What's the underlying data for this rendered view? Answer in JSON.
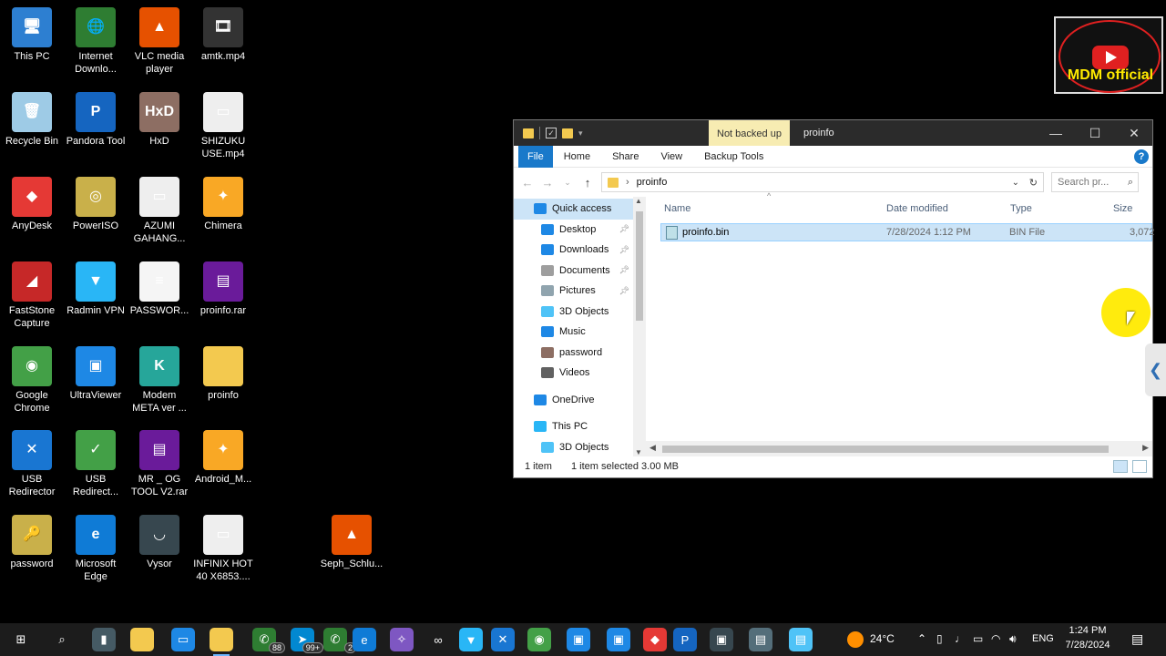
{
  "desktop": {
    "icons": [
      {
        "label": "This PC",
        "icon": "this-pc-icon",
        "color": "#2d7fd1",
        "glyph": "🖥",
        "shortcut": false
      },
      {
        "label": "Internet\nDownlo...",
        "icon": "idm-icon",
        "color": "#2e7d32",
        "glyph": "🌐",
        "shortcut": true
      },
      {
        "label": "VLC media\nplayer",
        "icon": "vlc-icon",
        "color": "#e65100",
        "glyph": "▲",
        "shortcut": true
      },
      {
        "label": "amtk.mp4",
        "icon": "video-file-icon",
        "color": "#333333",
        "glyph": "🎞",
        "shortcut": false
      },
      {
        "label": "Recycle Bin",
        "icon": "recycle-bin-icon",
        "color": "#9ecbe6",
        "glyph": "🗑",
        "shortcut": false
      },
      {
        "label": "Pandora Tool",
        "icon": "pandora-icon",
        "color": "#1565c0",
        "glyph": "P",
        "shortcut": true
      },
      {
        "label": "HxD",
        "icon": "hxd-icon",
        "color": "#8d6e63",
        "glyph": "HxD",
        "shortcut": true
      },
      {
        "label": "SHIZUKU\nUSE.mp4",
        "icon": "video-file-icon",
        "color": "#eeeeee",
        "glyph": "▭",
        "shortcut": false
      },
      {
        "label": "AnyDesk",
        "icon": "anydesk-icon",
        "color": "#e53935",
        "glyph": "◆",
        "shortcut": false
      },
      {
        "label": "PowerISO",
        "icon": "poweriso-icon",
        "color": "#c9b04a",
        "glyph": "◎",
        "shortcut": true
      },
      {
        "label": "AZUMI\nGAHANG...",
        "icon": "video-file-icon",
        "color": "#eeeeee",
        "glyph": "▭",
        "shortcut": false
      },
      {
        "label": "Chimera",
        "icon": "chimera-icon",
        "color": "#f9a825",
        "glyph": "✦",
        "shortcut": true
      },
      {
        "label": "FastStone\nCapture",
        "icon": "faststone-icon",
        "color": "#c62828",
        "glyph": "◢",
        "shortcut": true
      },
      {
        "label": "Radmin VPN",
        "icon": "radmin-vpn-icon",
        "color": "#29b6f6",
        "glyph": "▼",
        "shortcut": true
      },
      {
        "label": "PASSWOR...",
        "icon": "text-file-icon",
        "color": "#f5f5f5",
        "glyph": "≡",
        "shortcut": false
      },
      {
        "label": "proinfo.rar",
        "icon": "rar-archive-icon",
        "color": "#6a1b9a",
        "glyph": "▤",
        "shortcut": false
      },
      {
        "label": "Google\nChrome",
        "icon": "chrome-icon",
        "color": "#43a047",
        "glyph": "◉",
        "shortcut": true
      },
      {
        "label": "UltraViewer",
        "icon": "ultraviewer-icon",
        "color": "#1e88e5",
        "glyph": "▣",
        "shortcut": true
      },
      {
        "label": "Modem\nMETA ver ...",
        "icon": "modem-meta-icon",
        "color": "#26a69a",
        "glyph": "K",
        "shortcut": true
      },
      {
        "label": "proinfo",
        "icon": "folder-icon",
        "color": "#f3c94f",
        "glyph": "",
        "shortcut": false
      },
      {
        "label": "USB\nRedirector",
        "icon": "usb-redirector-icon",
        "color": "#1976d2",
        "glyph": "✕",
        "shortcut": true
      },
      {
        "label": "USB\nRedirect...",
        "icon": "usb-redirector-client-icon",
        "color": "#43a047",
        "glyph": "✓",
        "shortcut": true
      },
      {
        "label": "MR _ OG\nTOOL V2.rar",
        "icon": "rar-archive-icon",
        "color": "#6a1b9a",
        "glyph": "▤",
        "shortcut": false
      },
      {
        "label": "Android_M...",
        "icon": "android-tool-icon",
        "color": "#f9a825",
        "glyph": "✦",
        "shortcut": true
      },
      {
        "label": "password",
        "icon": "keys-icon",
        "color": "#c9b04a",
        "glyph": "🔑",
        "shortcut": true
      },
      {
        "label": "Microsoft\nEdge",
        "icon": "edge-icon",
        "color": "#0f7bd6",
        "glyph": "e",
        "shortcut": true
      },
      {
        "label": "Vysor",
        "icon": "vysor-icon",
        "color": "#37474f",
        "glyph": "◡",
        "shortcut": true
      },
      {
        "label": "INFINIX HOT\n40 X6853....",
        "icon": "video-file-icon",
        "color": "#eeeeee",
        "glyph": "▭",
        "shortcut": false
      },
      {
        "label": "Seph_Schlu...",
        "icon": "vlc-icon",
        "color": "#e65100",
        "glyph": "▲",
        "shortcut": false
      }
    ]
  },
  "badge": {
    "text": "MDM official"
  },
  "explorer": {
    "title": "proinfo",
    "backup_badge": "Not backed up",
    "ribbon_tabs": [
      "File",
      "Home",
      "Share",
      "View",
      "Backup Tools"
    ],
    "help": "?",
    "address": "proinfo",
    "search_placeholder": "Search pr...",
    "nav": [
      {
        "label": "Quick access",
        "icon": "star-icon",
        "color": "#1e88e5",
        "pinned": false,
        "indent": 0
      },
      {
        "label": "Desktop",
        "icon": "desktop-icon",
        "color": "#1e88e5",
        "pinned": true,
        "indent": 1
      },
      {
        "label": "Downloads",
        "icon": "downloads-icon",
        "color": "#1e88e5",
        "pinned": true,
        "indent": 1
      },
      {
        "label": "Documents",
        "icon": "documents-icon",
        "color": "#9e9e9e",
        "pinned": true,
        "indent": 1
      },
      {
        "label": "Pictures",
        "icon": "pictures-icon",
        "color": "#90a4ae",
        "pinned": true,
        "indent": 1
      },
      {
        "label": "3D Objects",
        "icon": "3d-objects-icon",
        "color": "#4fc3f7",
        "pinned": false,
        "indent": 1
      },
      {
        "label": "Music",
        "icon": "music-icon",
        "color": "#1e88e5",
        "pinned": false,
        "indent": 1
      },
      {
        "label": "password",
        "icon": "password-folder-icon",
        "color": "#8d6e63",
        "pinned": false,
        "indent": 1
      },
      {
        "label": "Videos",
        "icon": "videos-icon",
        "color": "#616161",
        "pinned": false,
        "indent": 1
      },
      {
        "label": "OneDrive",
        "icon": "onedrive-icon",
        "color": "#1e88e5",
        "pinned": false,
        "indent": 0
      },
      {
        "label": "This PC",
        "icon": "this-pc-icon",
        "color": "#29b6f6",
        "pinned": false,
        "indent": 0
      },
      {
        "label": "3D Objects",
        "icon": "3d-objects-icon",
        "color": "#4fc3f7",
        "pinned": false,
        "indent": 1
      }
    ],
    "columns": [
      "Name",
      "Date modified",
      "Type",
      "Size"
    ],
    "files": [
      {
        "name": "proinfo.bin",
        "date": "7/28/2024 1:12 PM",
        "type": "BIN File",
        "size": "3,072"
      }
    ],
    "status": {
      "count": "1 item",
      "selected": "1 item selected  3.00 MB"
    }
  },
  "taskbar": {
    "items": [
      {
        "icon": "start-icon",
        "glyph": "⊞",
        "color": "#1c1c1c",
        "count": ""
      },
      {
        "icon": "search-icon",
        "glyph": "⌕",
        "color": "#1c1c1c",
        "count": ""
      },
      {
        "icon": "app-icon",
        "glyph": "▮",
        "color": "#455a64",
        "count": ""
      },
      {
        "icon": "file-explorer-icon",
        "glyph": "",
        "color": "#f3c94f",
        "count": ""
      },
      {
        "icon": "monitor-app-icon",
        "glyph": "▭",
        "color": "#1e88e5",
        "count": ""
      },
      {
        "icon": "file-explorer-active-icon",
        "glyph": "",
        "color": "#f3c94f",
        "count": ""
      },
      {
        "icon": "whatsapp-icon",
        "glyph": "✆",
        "color": "#2e7d32",
        "count": "88"
      },
      {
        "icon": "telegram-icon",
        "glyph": "➤",
        "color": "#0288d1",
        "count": "99+"
      },
      {
        "icon": "whatsapp-business-icon",
        "glyph": "✆",
        "color": "#2e7d32",
        "count": "2"
      },
      {
        "icon": "edge-icon",
        "glyph": "e",
        "color": "#0f7bd6",
        "count": ""
      },
      {
        "icon": "messenger-icon",
        "glyph": "✧",
        "color": "#7e57c2",
        "count": ""
      },
      {
        "icon": "infinity-icon",
        "glyph": "∞",
        "color": "#1c1c1c",
        "count": ""
      },
      {
        "icon": "radmin-vpn-icon",
        "glyph": "▼",
        "color": "#29b6f6",
        "count": ""
      },
      {
        "icon": "usb-redirector-icon",
        "glyph": "✕",
        "color": "#1976d2",
        "count": ""
      },
      {
        "icon": "chrome-icon",
        "glyph": "◉",
        "color": "#43a047",
        "count": ""
      },
      {
        "icon": "ultraviewer-icon",
        "glyph": "▣",
        "color": "#1e88e5",
        "count": ""
      },
      {
        "icon": "ultraviewer-2-icon",
        "glyph": "▣",
        "color": "#1e88e5",
        "count": ""
      },
      {
        "icon": "anydesk-icon",
        "glyph": "◆",
        "color": "#e53935",
        "count": ""
      },
      {
        "icon": "pandora-icon",
        "glyph": "P",
        "color": "#1565c0",
        "count": ""
      },
      {
        "icon": "terminal-app-icon",
        "glyph": "▣",
        "color": "#37474f",
        "count": ""
      },
      {
        "icon": "usb-device-icon",
        "glyph": "▤",
        "color": "#546e7a",
        "count": ""
      },
      {
        "icon": "notepad-icon",
        "glyph": "▤",
        "color": "#4fc3f7",
        "count": ""
      }
    ],
    "weather": "24°C",
    "language": "ENG",
    "time": "1:24 PM",
    "date": "7/28/2024"
  }
}
